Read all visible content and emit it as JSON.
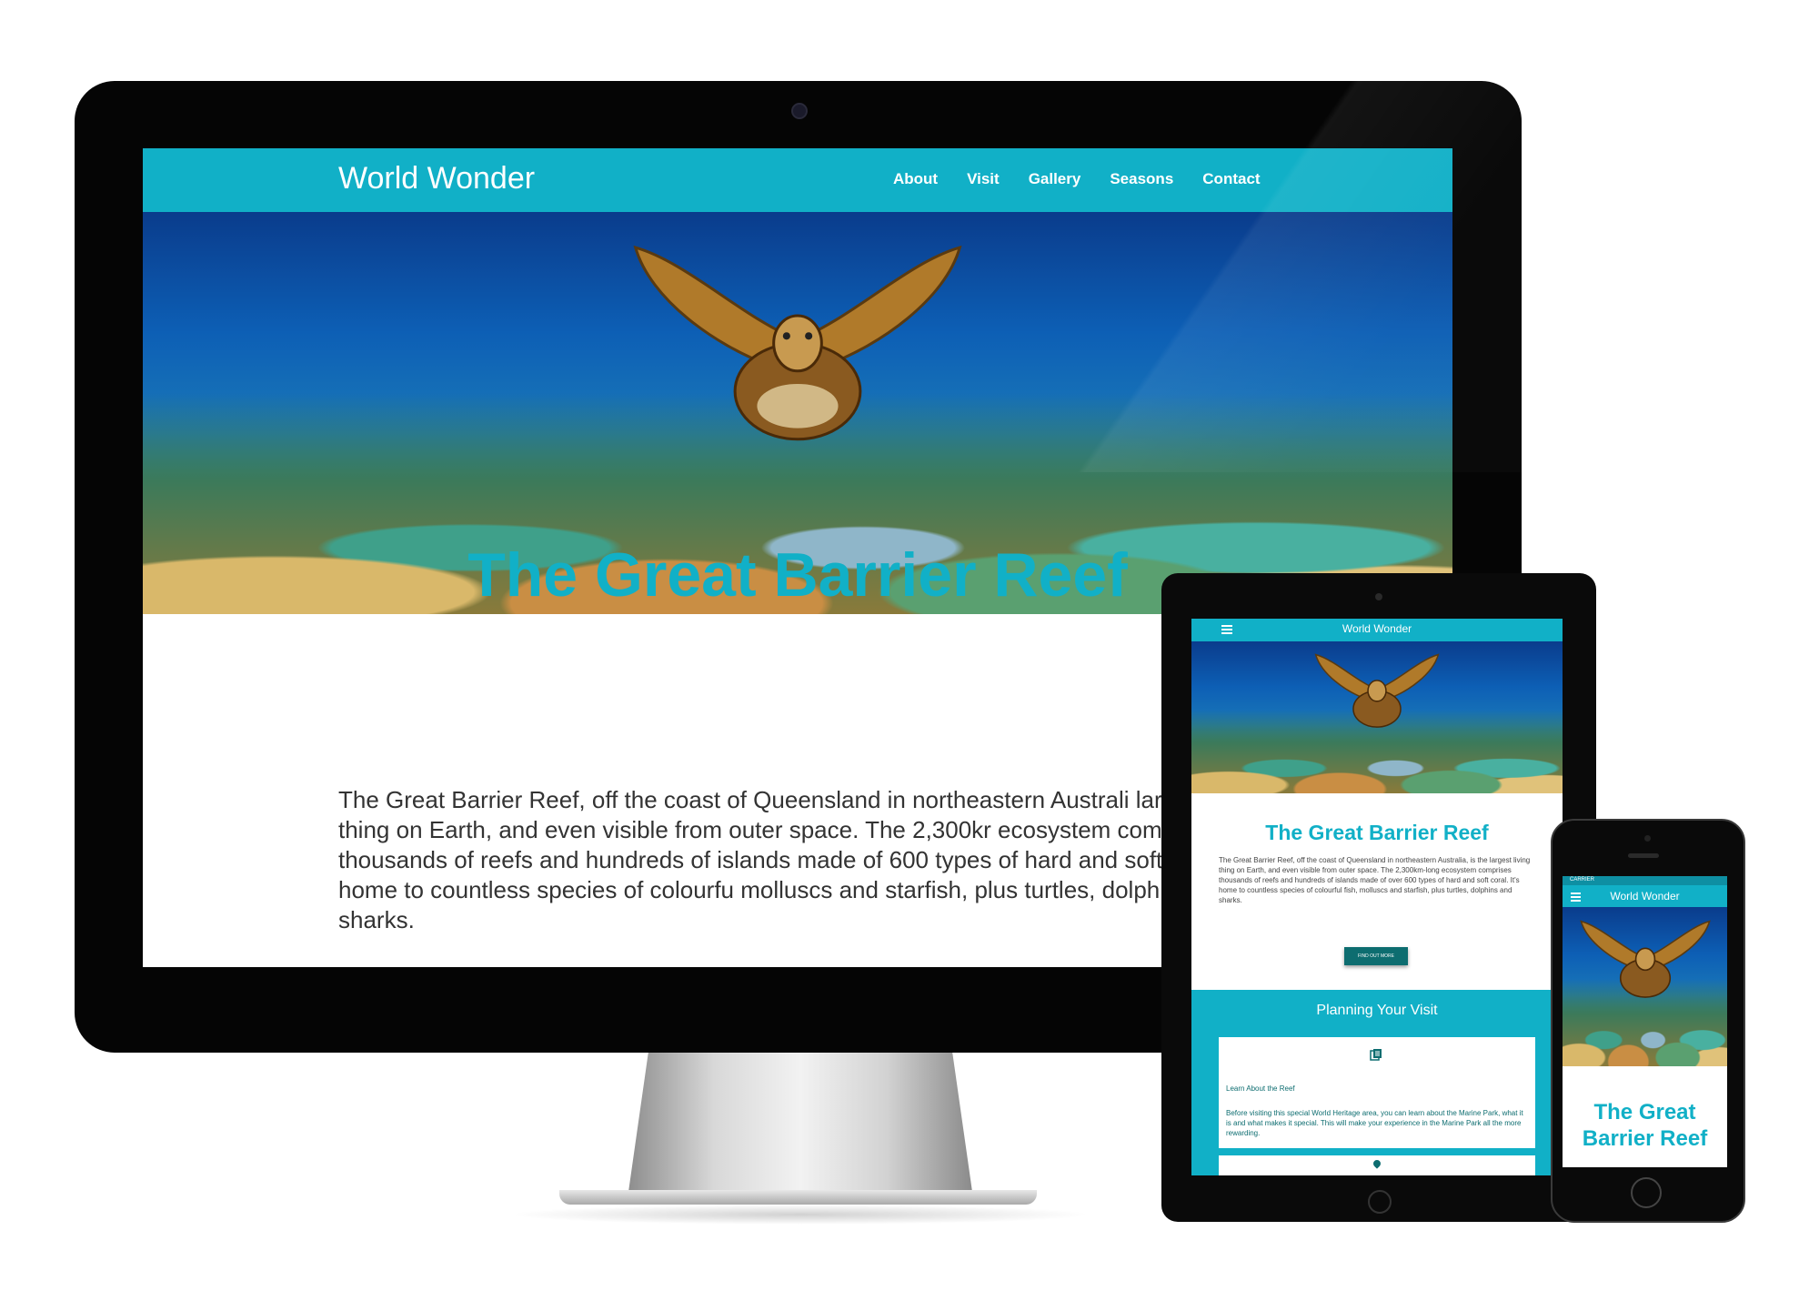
{
  "desktop": {
    "brand": "World Wonder",
    "nav": [
      "About",
      "Visit",
      "Gallery",
      "Seasons",
      "Contact"
    ],
    "title": "The Great Barrier Reef",
    "body": "The Great Barrier Reef, off the coast of Queensland in northeastern Australi largest living thing on Earth, and even visible from outer space. The 2,300kr ecosystem comprises thousands of reefs and hundreds of islands made of 600 types of hard and soft coral. It's home to countless species of colourfu molluscs and starfish, plus turtles, dolphins and sharks."
  },
  "tablet": {
    "brand": "World Wonder",
    "title": "The Great Barrier Reef",
    "body": "The Great Barrier Reef, off the coast of Queensland in northeastern Australia, is the largest living thing on Earth, and even visible from outer space. The 2,300km-long ecosystem comprises thousands of reefs and hundreds of islands made of over 600 types of hard and soft coral. It's home to countless species of colourful fish, molluscs and starfish, plus turtles, dolphins and sharks.",
    "button": "FIND OUT MORE",
    "plan_title": "Planning Your Visit",
    "card_title": "Learn About the Reef",
    "card_text": "Before visiting this special World Heritage area, you can learn about the Marine Park, what it is and what makes it special. This will make your experience in the Marine Park all the more rewarding."
  },
  "phone": {
    "carrier": "CARRIER",
    "brand": "World Wonder",
    "title": "The Great Barrier Reef"
  },
  "colors": {
    "accent": "#11b0c7",
    "button": "#0d6d70"
  },
  "icons": [
    "menu-icon",
    "book-icon",
    "map-pin-icon"
  ]
}
